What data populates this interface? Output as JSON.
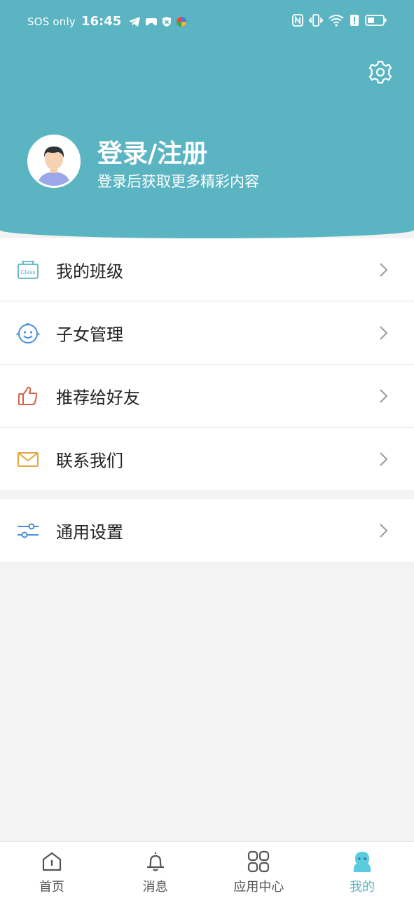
{
  "status_bar": {
    "carrier": "SOS only",
    "time": "16:45"
  },
  "header": {
    "login_title": "登录/注册",
    "login_subtitle": "登录后获取更多精彩内容",
    "background_color": "#5bb4c2"
  },
  "menu": {
    "group1": [
      {
        "label": "我的班级",
        "icon": "class-icon",
        "icon_text": "Class"
      },
      {
        "label": "子女管理",
        "icon": "child-face-icon"
      },
      {
        "label": "推荐给好友",
        "icon": "thumbs-up-icon"
      },
      {
        "label": "联系我们",
        "icon": "envelope-icon"
      }
    ],
    "group2": [
      {
        "label": "通用设置",
        "icon": "sliders-icon"
      }
    ]
  },
  "tabbar": {
    "tabs": [
      {
        "label": "首页",
        "icon": "home-icon"
      },
      {
        "label": "消息",
        "icon": "bell-icon"
      },
      {
        "label": "应用中心",
        "icon": "apps-grid-icon"
      },
      {
        "label": "我的",
        "icon": "profile-icon"
      }
    ],
    "active_index": 3,
    "accent_color": "#5bb4c2"
  }
}
